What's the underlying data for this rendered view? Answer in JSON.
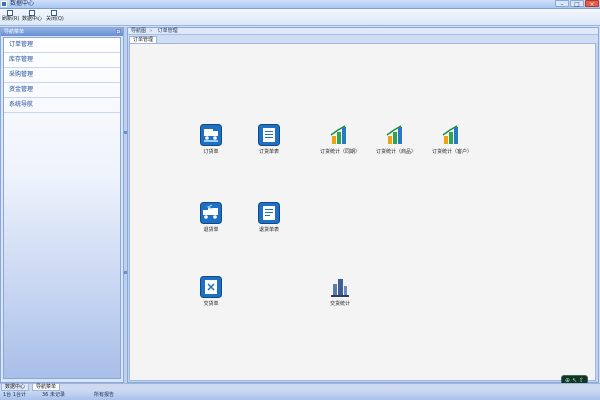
{
  "window": {
    "title": "数据中心",
    "buttons": [
      "–",
      "□",
      "×"
    ]
  },
  "toolbar": [
    {
      "label": "刷新(R)",
      "icon": "refresh-icon"
    },
    {
      "label": "数据中心",
      "icon": "data-center-icon"
    },
    {
      "label": "关闭(Q)",
      "icon": "close-app-icon"
    }
  ],
  "sidebar": {
    "title": "导航菜单",
    "collapse": "«",
    "items": [
      "订单管理",
      "库存管理",
      "采购管理",
      "资金管理",
      "系统导航"
    ]
  },
  "main": {
    "breadcrumb": [
      "导航图",
      "订单管理"
    ],
    "tab": "订单管理",
    "tiles": [
      {
        "label": "订货单",
        "icon": "order-truck-icon"
      },
      {
        "label": "订货单表",
        "icon": "order-list-icon"
      },
      {
        "label": "订货统计（同期）",
        "icon": "bar-chart-icon"
      },
      {
        "label": "订货统计（商品）",
        "icon": "bar-chart-icon"
      },
      {
        "label": "订货统计（客户）",
        "icon": "bar-chart-icon"
      },
      {
        "label": "退货单",
        "icon": "return-truck-icon"
      },
      {
        "label": "退货单表",
        "icon": "return-list-icon"
      },
      {
        "label": "交货单",
        "icon": "delivery-icon"
      },
      {
        "label": "交货统计",
        "icon": "building-chart-icon"
      }
    ],
    "widget": [
      "⊕",
      "↖",
      "⇧"
    ]
  },
  "bottom_tabs": [
    "数据中心",
    "导航菜单"
  ],
  "status": {
    "left": "1台 1台计",
    "mid": "36 未记录",
    "right": "所有报告"
  },
  "colors": {
    "accent": "#1f6fc2",
    "sidebar_text": "#1f4aa0",
    "title_bar": "#a9c6f1"
  }
}
